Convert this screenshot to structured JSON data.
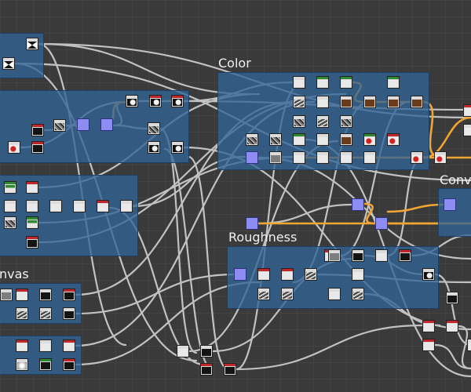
{
  "app": {
    "panel": "Graph editor"
  },
  "frames": {
    "color": {
      "title": "Color"
    },
    "roughness": {
      "title": "Roughness"
    },
    "canvas": {
      "title": "nvas"
    },
    "conv": {
      "title": "Conv"
    }
  },
  "colors": {
    "background": "#3a3a3a",
    "frame_fill": "#326496",
    "wire_grey": "#bdbdbd",
    "wire_orange": "#f0a030",
    "purple_node": "#8c8cf2",
    "red_bar": "#c0272d",
    "green_bar": "#2f8a2f"
  },
  "icons": {
    "node_types": [
      "purple-input-node",
      "texture-node",
      "noise-node",
      "blend-node",
      "mask-node",
      "output-node"
    ]
  }
}
